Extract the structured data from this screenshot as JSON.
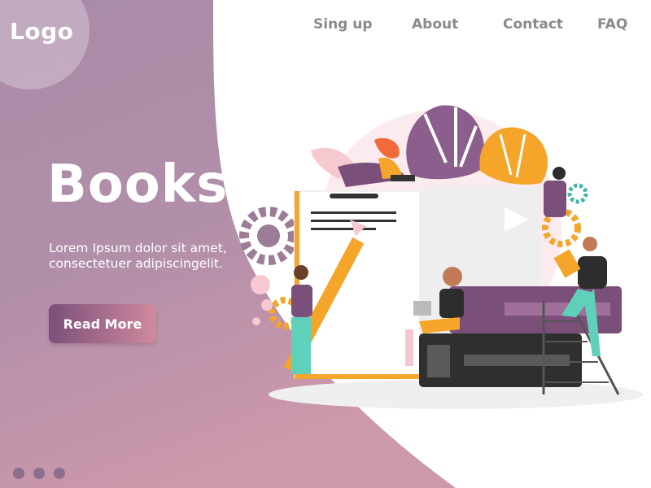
{
  "header": {
    "logo_text": "Logo",
    "nav_items": [
      "Sing up",
      "About",
      "Contact",
      "FAQ"
    ]
  },
  "hero": {
    "title": "Books",
    "description_lines": [
      "Lorem Ipsum dolor sit amet,",
      "consectetuer adipiscingelit."
    ],
    "cta_label": "Read More"
  },
  "pagination": {
    "dots": 3,
    "active_index": 0
  },
  "colors": {
    "panel_top": "#a98aa8",
    "panel_bottom": "#c494aa",
    "accent_orange": "#f5a52a",
    "accent_purple": "#6b4a6e",
    "nav_text": "#8a8a8a",
    "dot_color": "#8e6e8d"
  },
  "illustration": {
    "icons": [
      "monstera-leaf-icon",
      "gear-icon",
      "pencil-icon",
      "book-icon",
      "laptop-icon",
      "ladder-icon"
    ]
  }
}
